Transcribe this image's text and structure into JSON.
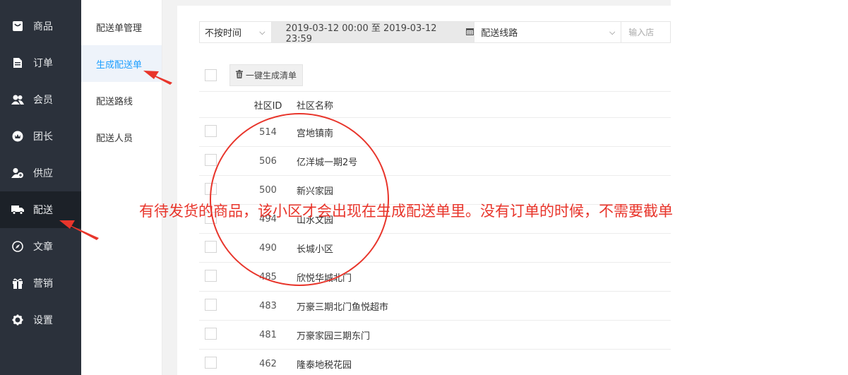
{
  "sidebar": {
    "items": [
      {
        "label": "商品",
        "icon": "goods-icon"
      },
      {
        "label": "订单",
        "icon": "order-icon"
      },
      {
        "label": "会员",
        "icon": "member-icon"
      },
      {
        "label": "团长",
        "icon": "leader-icon"
      },
      {
        "label": "供应",
        "icon": "supply-icon"
      },
      {
        "label": "配送",
        "icon": "truck-icon",
        "active": true
      },
      {
        "label": "文章",
        "icon": "compass-icon"
      },
      {
        "label": "营销",
        "icon": "gift-icon"
      },
      {
        "label": "设置",
        "icon": "gear-icon"
      }
    ]
  },
  "subnav": {
    "items": [
      {
        "label": "配送单管理"
      },
      {
        "label": "生成配送单",
        "active": true
      },
      {
        "label": "配送路线"
      },
      {
        "label": "配送人员"
      }
    ]
  },
  "filters": {
    "time_type": "不按时间",
    "date_range": "2019-03-12 00:00 至 2019-03-12 23:59",
    "route": "配送线路",
    "store_placeholder": "输入店"
  },
  "toolbar": {
    "generate_label": "一键生成清单"
  },
  "table": {
    "headers": [
      "社区ID",
      "社区名称"
    ],
    "rows": [
      {
        "id": "514",
        "name": "宫地镇南"
      },
      {
        "id": "506",
        "name": "亿洋城一期2号"
      },
      {
        "id": "500",
        "name": "新兴家园"
      },
      {
        "id": "494",
        "name": "山水文园"
      },
      {
        "id": "490",
        "name": "长城小区"
      },
      {
        "id": "485",
        "name": "欣悦华城北门"
      },
      {
        "id": "483",
        "name": "万豪三期北门鱼悦超市"
      },
      {
        "id": "481",
        "name": "万豪家园三期东门"
      },
      {
        "id": "462",
        "name": "隆泰地税花园"
      }
    ]
  },
  "annotation": {
    "text": "有待发货的商品，该小区才会出现在生成配送单里。没有订单的时候，不需要截单",
    "color": "#e8352b"
  },
  "colors": {
    "sidebar_bg": "#2b313b",
    "accent": "#1e9fff"
  }
}
